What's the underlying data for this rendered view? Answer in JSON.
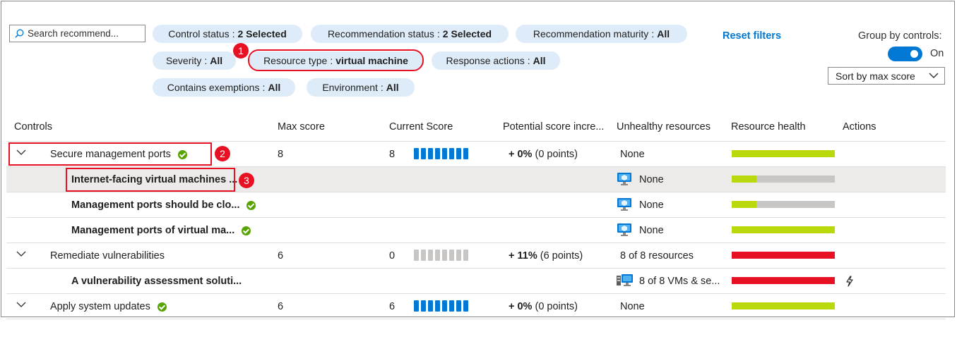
{
  "search": {
    "placeholder": "Search recommend..."
  },
  "filters": [
    {
      "label": "Control status",
      "value": "2 Selected"
    },
    {
      "label": "Recommendation status",
      "value": "2 Selected"
    },
    {
      "label": "Recommendation maturity",
      "value": "All"
    },
    {
      "label": "Severity",
      "value": "All"
    },
    {
      "label": "Resource type",
      "value": "virtual machine"
    },
    {
      "label": "Response actions",
      "value": "All"
    },
    {
      "label": "Contains exemptions",
      "value": "All"
    },
    {
      "label": "Environment",
      "value": "All"
    }
  ],
  "filter_separator": ":",
  "reset_filters": "Reset filters",
  "group_by": {
    "label": "Group by controls:",
    "state": "On"
  },
  "sort": {
    "value": "Sort by max score"
  },
  "callouts": [
    "1",
    "2",
    "3"
  ],
  "columns": [
    "Controls",
    "Max score",
    "Current Score",
    "Potential score incre...",
    "Unhealthy resources",
    "Resource health",
    "Actions"
  ],
  "rows": [
    {
      "type": "control",
      "name": "Secure management ports",
      "check": true,
      "max": "8",
      "current": "8",
      "filled": 8,
      "increase": "+ 0%",
      "points": "(0 points)",
      "unhealthy": "None",
      "health": [
        1.0,
        0.0,
        0.0
      ]
    },
    {
      "type": "rec",
      "name": "Internet-facing virtual machines ...",
      "check": false,
      "unhealthy": "None",
      "icon": "vm-icon",
      "health": [
        0.24,
        0.0,
        0.76
      ]
    },
    {
      "type": "rec",
      "name": "Management ports should be clo...",
      "check": true,
      "unhealthy": "None",
      "icon": "vm-icon",
      "health": [
        0.24,
        0.0,
        0.76
      ]
    },
    {
      "type": "rec",
      "name": "Management ports of virtual ma...",
      "check": true,
      "unhealthy": "None",
      "icon": "vm-icon",
      "health": [
        1.0,
        0.0,
        0.0
      ]
    },
    {
      "type": "control",
      "name": "Remediate vulnerabilities",
      "check": false,
      "max": "6",
      "current": "0",
      "filled": 0,
      "increase": "+ 11%",
      "points": "(6 points)",
      "unhealthy": "8 of 8 resources",
      "health": [
        0.0,
        1.0,
        0.0
      ]
    },
    {
      "type": "rec",
      "name": "A vulnerability assessment soluti...",
      "check": false,
      "unhealthy": "8 of 8 VMs & se...",
      "icon": "vm-group-icon",
      "health": [
        0.0,
        1.0,
        0.0
      ],
      "action": "lightning-icon"
    },
    {
      "type": "control",
      "name": "Apply system updates",
      "check": true,
      "max": "6",
      "current": "6",
      "filled": 8,
      "increase": "+ 0%",
      "points": "(0 points)",
      "unhealthy": "None",
      "health": [
        1.0,
        0.0,
        0.0
      ]
    }
  ],
  "colors": {
    "healthy": "#bad80a",
    "unhealthy": "#e81123",
    "notapplicable": "#c8c6c4",
    "accent": "#0078d4",
    "callout": "#e81123"
  }
}
